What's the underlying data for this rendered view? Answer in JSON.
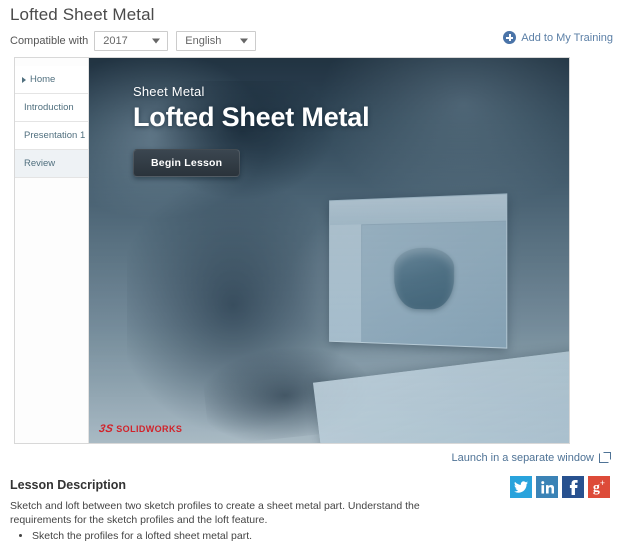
{
  "header": {
    "title": "Lofted Sheet Metal",
    "compatible_label": "Compatible with",
    "version_select": {
      "value": "2017",
      "options": [
        "2017"
      ]
    },
    "language_select": {
      "value": "English",
      "options": [
        "English"
      ]
    },
    "add_to_training": {
      "label": "Add to My Training",
      "icon": "plus-circle-icon",
      "color": "#4a74a8"
    }
  },
  "player": {
    "nav": {
      "items": [
        {
          "label": "Home",
          "active": false,
          "marker": true
        },
        {
          "label": "Introduction",
          "active": false,
          "marker": false
        },
        {
          "label": "Presentation 1",
          "active": false,
          "marker": false
        },
        {
          "label": "Review",
          "active": true,
          "marker": false
        }
      ]
    },
    "hero": {
      "eyebrow": "Sheet Metal",
      "title": "Lofted Sheet Metal",
      "begin_button": "Begin Lesson",
      "logo_text": "SOLIDWORKS",
      "logo_mark": "3S",
      "logo_color": "#d1232a"
    }
  },
  "launch": {
    "label": "Launch in a separate window",
    "icon": "external-link-icon",
    "color": "#4f7396"
  },
  "social": [
    {
      "name": "twitter",
      "glyph": "twitter-icon",
      "color": "#29a3dc"
    },
    {
      "name": "linkedin",
      "glyph": "linkedin-icon",
      "color": "#3b83b6"
    },
    {
      "name": "facebook",
      "glyph": "facebook-icon",
      "color": "#28518f"
    },
    {
      "name": "googleplus",
      "glyph": "google-plus-icon",
      "color": "#dd4b39"
    }
  ],
  "description": {
    "title": "Lesson Description",
    "body": "Sketch and loft between two sketch profiles to create a sheet metal part. Understand the requirements for the sketch profiles and the loft feature.",
    "bullets": [
      "Sketch the profiles for a lofted sheet metal part."
    ]
  }
}
